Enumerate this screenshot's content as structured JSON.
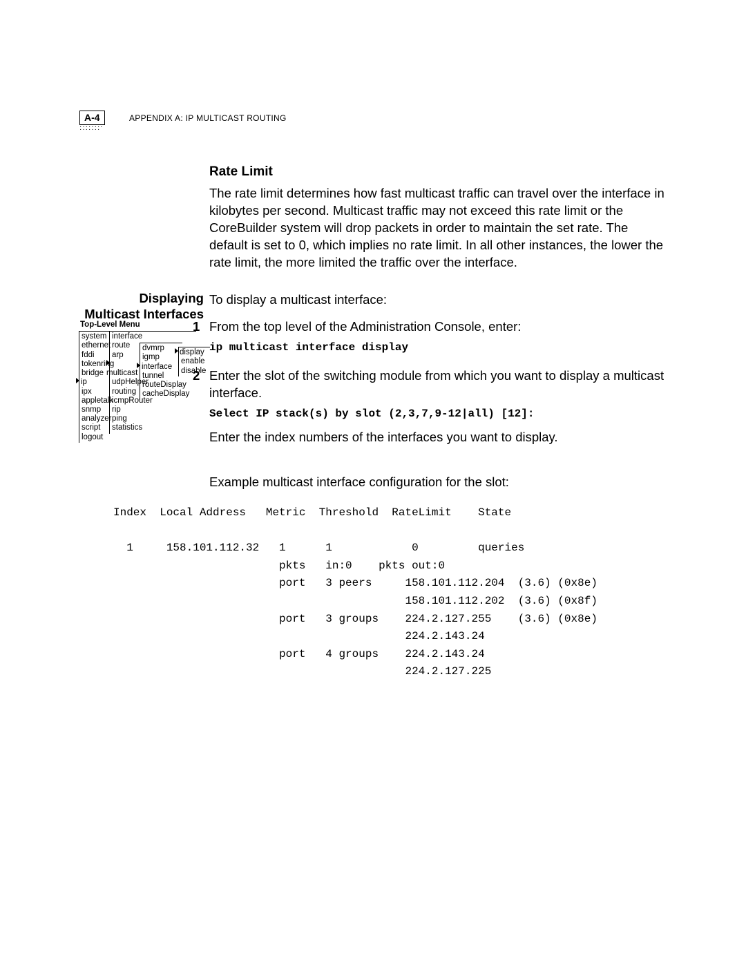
{
  "header": {
    "page_num": "A-4",
    "appendix_upper": "APPENDIX A: IP MULTICAST ROUTING"
  },
  "rate_limit": {
    "heading": "Rate Limit",
    "body": "The rate limit determines how fast multicast traffic can travel over the interface in kilobytes per second. Multicast traffic may not exceed this rate limit or the CoreBuilder system will drop packets in order to maintain the set rate. The default is set to 0, which implies no rate limit. In all other instances, the lower the rate limit, the more limited the traffic over the interface."
  },
  "displaying": {
    "side_label_line1": "Displaying",
    "side_label_line2": "Multicast Interfaces",
    "intro": "To display a multicast interface:",
    "step1_text": "From the top level of the Administration Console, enter:",
    "step1_cmd": "ip multicast interface display",
    "step2_text": "Enter the slot of the switching module from which you want to display a multicast interface.",
    "step2_prompt": "Select IP stack(s) by slot (2,3,7,9-12|all) [12]:",
    "step2_followup": "Enter the index numbers of the interfaces you want to display.",
    "example_intro": "Example multicast interface configuration for the slot:"
  },
  "menu": {
    "title": "Top-Level Menu",
    "col1": [
      "system",
      "ethernet",
      "fddi",
      "tokenring",
      "bridge",
      "ip",
      "ipx",
      "appletalk",
      "snmp",
      "analyzer",
      "script",
      "logout"
    ],
    "col1_selected_index": 5,
    "col2": [
      "interface",
      "route",
      "arp",
      "multicast",
      "udpHelper",
      "routing",
      "icmpRouter",
      "rip",
      "ping",
      "statistics"
    ],
    "col2_selected_index": 3,
    "col3": [
      "dvmrp",
      "igmp",
      "interface",
      "tunnel",
      "routeDisplay",
      "cacheDisplay"
    ],
    "col3_selected_index": 2,
    "col4": [
      "display",
      "enable",
      "disable"
    ],
    "col4_selected_index": 0
  },
  "example_output": "Index  Local Address   Metric  Threshold  RateLimit    State\n\n  1     158.101.112.32   1      1            0         queries\n                         pkts   in:0    pkts out:0\n                         port   3 peers     158.101.112.204  (3.6) (0x8e)\n                                            158.101.112.202  (3.6) (0x8f)\n                         port   3 groups    224.2.127.255    (3.6) (0x8e)\n                                            224.2.143.24\n                         port   4 groups    224.2.143.24\n                                            224.2.127.225"
}
